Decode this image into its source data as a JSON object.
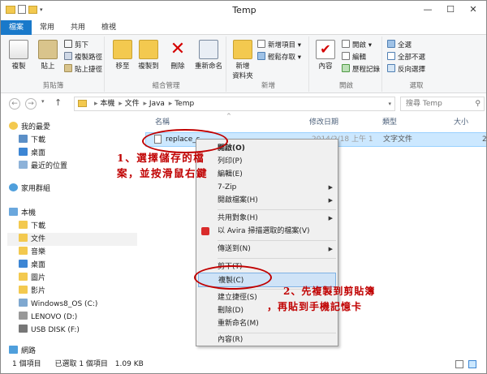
{
  "title": "Temp",
  "window_controls": {
    "min": "—",
    "max": "☐",
    "close": "✕"
  },
  "tabs": [
    "檔案",
    "常用",
    "共用",
    "檢視"
  ],
  "ribbon": {
    "clipboard": {
      "label": "剪貼簿",
      "copy": "複製",
      "paste": "貼上",
      "cut": "剪下",
      "copy_path": "複製路徑",
      "paste_shortcut": "貼上捷徑"
    },
    "organize": {
      "label": "組合管理",
      "move_to": "移至",
      "copy_to": "複製到",
      "delete": "刪除",
      "rename": "重新命名"
    },
    "new": {
      "label": "新增",
      "new_folder": "新增\n資料夾",
      "new_item": "新增項目 ▾",
      "easy_access": "輕鬆存取 ▾"
    },
    "open": {
      "label": "開啟",
      "properties": "內容",
      "open": "開啟 ▾",
      "edit": "編輯",
      "history": "歷程記錄"
    },
    "select": {
      "label": "選取",
      "select_all": "全選",
      "select_none": "全部不選",
      "invert": "反向選擇"
    }
  },
  "address": {
    "crumbs": [
      "本機",
      "文件",
      "Java",
      "Temp"
    ],
    "search_placeholder": "搜尋 Temp"
  },
  "sidebar": [
    {
      "label": "我的最愛",
      "kind": "star"
    },
    {
      "label": "下載",
      "kind": "folder"
    },
    {
      "label": "桌面",
      "kind": "desktop"
    },
    {
      "label": "最近的位置",
      "kind": "recent"
    },
    {
      "label": "家用群組",
      "kind": "home"
    },
    {
      "label": "本機",
      "kind": "pc"
    },
    {
      "label": "下載",
      "kind": "folder"
    },
    {
      "label": "文件",
      "kind": "doc"
    },
    {
      "label": "音樂",
      "kind": "music"
    },
    {
      "label": "桌面",
      "kind": "desktop"
    },
    {
      "label": "圖片",
      "kind": "pic"
    },
    {
      "label": "影片",
      "kind": "video"
    },
    {
      "label": "Windows8_OS (C:)",
      "kind": "drive"
    },
    {
      "label": "LENOVO (D:)",
      "kind": "drive"
    },
    {
      "label": "USB DISK (F:)",
      "kind": "usb"
    },
    {
      "label": "網路",
      "kind": "net"
    }
  ],
  "columns": {
    "name": "名稱",
    "date": "修改日期",
    "type": "類型",
    "size": "大小"
  },
  "file": {
    "name": "replace_s",
    "date": "2014/2/18 上午 1",
    "type": "文字文件",
    "size": "2"
  },
  "context_menu": [
    {
      "label": "開啟(O)",
      "bold": true
    },
    {
      "label": "列印(P)"
    },
    {
      "label": "編輯(E)"
    },
    {
      "label": "7-Zip",
      "sub": true
    },
    {
      "label": "開啟檔案(H)",
      "sub": true
    },
    {
      "sep": true
    },
    {
      "label": "共用對象(H)",
      "sub": true
    },
    {
      "label": "以 Avira 掃描選取的檔案(V)",
      "icon": true
    },
    {
      "sep": true
    },
    {
      "label": "傳送到(N)",
      "sub": true
    },
    {
      "sep": true
    },
    {
      "label": "剪下(T)"
    },
    {
      "label": "複製(C)",
      "highlight": true
    },
    {
      "sep": true
    },
    {
      "label": "建立捷徑(S)"
    },
    {
      "label": "刪除(D)"
    },
    {
      "label": "重新命名(M)"
    },
    {
      "sep": true
    },
    {
      "label": "內容(R)"
    }
  ],
  "status": {
    "count": "1 個項目",
    "selected": "已選取 1 個項目",
    "size": "1.09 KB"
  },
  "annotations": {
    "step1": "1、選擇儲存的檔案，並按滑鼠右鍵",
    "step2_line1": "2、先複製到剪貼簿",
    "step2_line2": "，再貼到手機記憶卡"
  },
  "colors": {
    "accent": "#1979ca",
    "annotation": "#c00000",
    "selection": "#cce8ff"
  }
}
